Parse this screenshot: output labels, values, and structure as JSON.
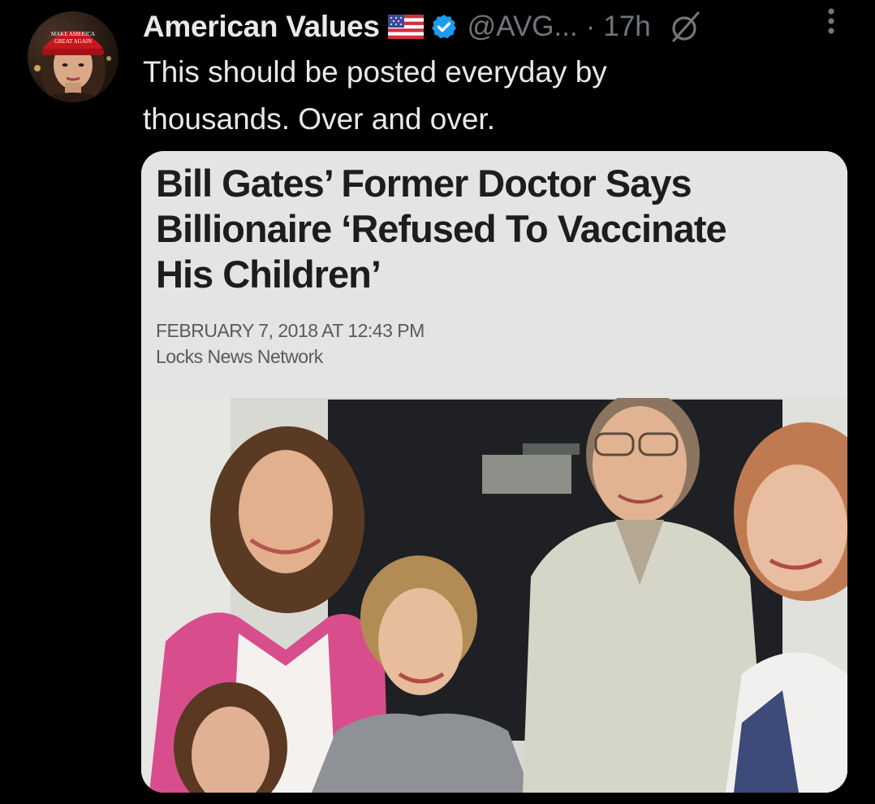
{
  "tweet": {
    "author": {
      "display_name": "American Values",
      "handle": "@AVG...",
      "avatar": "avatar-photo",
      "flag_icon": "us-flag-icon",
      "verified_icon": "verified-badge-icon"
    },
    "separator": "·",
    "timestamp": "17h",
    "grok_icon": "grok-icon",
    "more_icon": "more-options-icon",
    "text_lines": [
      "This should be posted everyday by",
      "thousands. Over and over."
    ],
    "media": {
      "headline_lines": [
        "Bill Gates’ Former Doctor Says",
        "Billionaire ‘Refused To Vaccinate",
        "His Children’"
      ],
      "dateline": "FEBRUARY 7, 2018 AT 12:43 PM",
      "source": "Locks News Network",
      "photo": "family-photo"
    }
  },
  "colors": {
    "background": "#000000",
    "primary_text": "#e7e9ea",
    "secondary_text": "#71767b",
    "verified_blue": "#1d9bf0"
  }
}
